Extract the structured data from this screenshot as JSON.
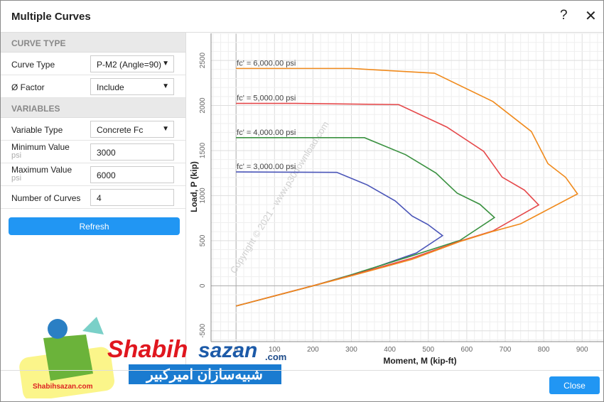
{
  "dialog": {
    "title": "Multiple Curves",
    "help_icon": "question-icon",
    "close_icon": "close-icon",
    "close_label": "Close"
  },
  "panel": {
    "curve_type_header": "CURVE TYPE",
    "curve_type": {
      "label": "Curve Type",
      "value": "P-M2 (Angle=90)"
    },
    "phi_factor": {
      "label": "Ø Factor",
      "value": "Include"
    },
    "variables_header": "VARIABLES",
    "variable_type": {
      "label": "Variable Type",
      "value": "Concrete Fc"
    },
    "min_value": {
      "label": "Minimum Value",
      "unit": "psi",
      "value": "3000"
    },
    "max_value": {
      "label": "Maximum Value",
      "unit": "psi",
      "value": "6000"
    },
    "num_curves": {
      "label": "Number of Curves",
      "value": "4"
    },
    "refresh_label": "Refresh"
  },
  "watermark": "Copyright © 2021 - www.p30download.com",
  "logo": {
    "brand_red": "Shabih",
    "brand_blue": "sazan",
    ".com": ".com",
    "persian": "شبیه‌سازان امیرکبیر",
    "small": "Shabihsazan.com"
  },
  "chart_data": {
    "type": "line",
    "xlabel": "Moment, M (kip-ft)",
    "ylabel": "Load, P (kip)",
    "xlim": [
      -65,
      955
    ],
    "ylim": [
      -620,
      2800
    ],
    "xticks": [
      0,
      100,
      200,
      300,
      400,
      500,
      600,
      700,
      800,
      900
    ],
    "yticks": [
      -500,
      0,
      500,
      1000,
      1500,
      2000,
      2500
    ],
    "grid": true,
    "series": [
      {
        "name": "fc' = 3,000.00 psi",
        "color": "#4a55b8",
        "points": [
          [
            0,
            1263
          ],
          [
            262,
            1258
          ],
          [
            341,
            1119
          ],
          [
            414,
            941
          ],
          [
            458,
            773
          ],
          [
            499,
            679
          ],
          [
            537,
            556
          ],
          [
            469,
            364
          ],
          [
            307,
            123
          ],
          [
            201,
            0
          ],
          [
            0,
            -225
          ]
        ]
      },
      {
        "name": "fc' = 4,000.00 psi",
        "color": "#3a9140",
        "points": [
          [
            0,
            1643
          ],
          [
            334,
            1643
          ],
          [
            441,
            1454
          ],
          [
            520,
            1250
          ],
          [
            575,
            1027
          ],
          [
            634,
            904
          ],
          [
            672,
            757
          ],
          [
            582,
            503
          ],
          [
            458,
            333
          ],
          [
            300,
            123
          ],
          [
            201,
            0
          ],
          [
            0,
            -225
          ]
        ]
      },
      {
        "name": "fc' = 5,000.00 psi",
        "color": "#e5484a",
        "points": [
          [
            0,
            2023
          ],
          [
            155,
            2023
          ],
          [
            423,
            2010
          ],
          [
            548,
            1761
          ],
          [
            644,
            1491
          ],
          [
            692,
            1205
          ],
          [
            750,
            1061
          ],
          [
            787,
            896
          ],
          [
            668,
            608
          ],
          [
            582,
            495
          ],
          [
            458,
            307
          ],
          [
            300,
            115
          ],
          [
            200,
            0
          ],
          [
            0,
            -225
          ]
        ]
      },
      {
        "name": "fc' = 6,000.00 psi",
        "color": "#f08a1c",
        "points": [
          [
            0,
            2411
          ],
          [
            299,
            2411
          ],
          [
            516,
            2358
          ],
          [
            668,
            2044
          ],
          [
            768,
            1711
          ],
          [
            811,
            1355
          ],
          [
            857,
            1203
          ],
          [
            888,
            1019
          ],
          [
            740,
            687
          ],
          [
            665,
            600
          ],
          [
            582,
            490
          ],
          [
            458,
            293
          ],
          [
            300,
            110
          ],
          [
            201,
            0
          ],
          [
            0,
            -225
          ]
        ]
      }
    ]
  }
}
